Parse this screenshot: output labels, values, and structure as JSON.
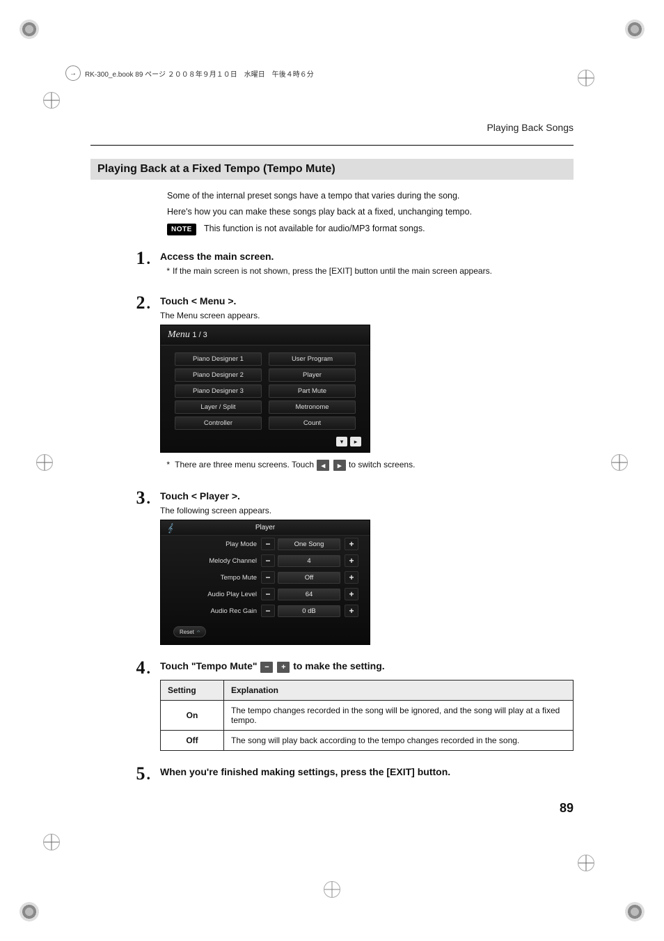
{
  "doc": {
    "print_header": "RK-300_e.book  89 ページ  ２００８年９月１０日　水曜日　午後４時６分",
    "running_head": "Playing Back Songs",
    "page_number": "89"
  },
  "section": {
    "title": "Playing Back at a Fixed Tempo (Tempo Mute)",
    "intro1": "Some of the internal preset songs have a tempo that varies during the song.",
    "intro2": "Here's how you can make these songs play back at a fixed, unchanging tempo.",
    "note_badge": "NOTE",
    "note_text": "This function is not available for audio/MP3 format songs."
  },
  "steps": {
    "s1": {
      "num": "1",
      "title": "Access the main screen.",
      "aside": "If the main screen is not shown, press the [EXIT] button until the main screen appears."
    },
    "s2": {
      "num": "2",
      "title": "Touch < Menu >.",
      "sub": "The Menu screen appears.",
      "aside": "There are three menu screens. Touch",
      "aside_tail": "to switch screens."
    },
    "s3": {
      "num": "3",
      "title": "Touch < Player >.",
      "sub": "The following screen appears."
    },
    "s4": {
      "num": "4",
      "title_pre": "Touch \"Tempo Mute\"",
      "title_post": "to make the setting."
    },
    "s5": {
      "num": "5",
      "title": "When you're finished making settings, press the [EXIT] button."
    }
  },
  "menu_shot": {
    "title_prefix": "Menu",
    "title_frac": "1 / 3",
    "cells": [
      "Piano Designer 1",
      "User Program",
      "Piano Designer 2",
      "Player",
      "Piano Designer 3",
      "Part Mute",
      "Layer / Split",
      "Metronome",
      "Controller",
      "Count"
    ]
  },
  "player_shot": {
    "title": "Player",
    "rows": [
      {
        "label": "Play Mode",
        "value": "One Song"
      },
      {
        "label": "Melody Channel",
        "value": "4"
      },
      {
        "label": "Tempo Mute",
        "value": "Off"
      },
      {
        "label": "Audio Play Level",
        "value": "64"
      },
      {
        "label": "Audio Rec Gain",
        "value": "0 dB"
      }
    ],
    "reset": "Reset"
  },
  "settings_table": {
    "head_setting": "Setting",
    "head_explanation": "Explanation",
    "rows": [
      {
        "key": "On",
        "val": "The tempo changes recorded in the song will be ignored, and the song will play at a fixed tempo."
      },
      {
        "key": "Off",
        "val": "The song will play back according to the tempo changes recorded in the song."
      }
    ]
  }
}
